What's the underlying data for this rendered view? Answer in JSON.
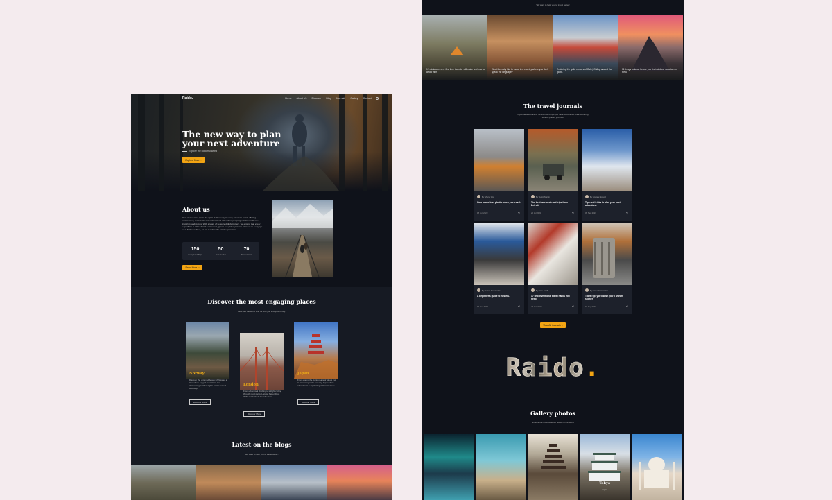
{
  "left": {
    "nav": {
      "logo": "Raido.",
      "links": [
        "Home",
        "About Us",
        "Discover",
        "Blog",
        "Journals",
        "Gallery",
        "Contact"
      ]
    },
    "hero": {
      "title": "The new way to plan your next adventure",
      "subtitle": "Explore the colourful world",
      "cta": "Explore More"
    },
    "about": {
      "title": "About us",
      "body": "Our mission is to ignite the spirit of discovery in every traveler's heart, offering meticulously crafted itineraries that blend adrenaline-pumping activities with awe-inspiring landscapes. With a team of seasoned globetrotters, we ensure that every expedition is infused with excitement, grows our global passion. Join us on a voyage of a lifetime with us, as we redefine the art of exploration.",
      "stats": [
        {
          "value": "150",
          "label": "Completed Trips"
        },
        {
          "value": "50",
          "label": "Tour Guides"
        },
        {
          "value": "70",
          "label": "Destinations"
        }
      ],
      "cta": "Read More"
    },
    "discover": {
      "title": "Discover the most engaging places",
      "subtitle": "Let's see the world with us with you and your family.",
      "cards": [
        {
          "name": "Norway",
          "desc": "Discover the untamed beauty of Norway, a land where rugged mountains, and shimmering northern lights paint a surreal backdrop.",
          "cta": "Discover More"
        },
        {
          "name": "London",
          "desc": "From urban rock climbing to twilight cycling through royal parks, London has endless thrills and hotbeds for adventure.",
          "cta": "Discover More"
        },
        {
          "name": "Japan",
          "desc": "From scaling the iconic peaks of Mount Fuji to immersing in the serenity, Japan offers adventurers a captivating cultural treasure.",
          "cta": "Discover More"
        }
      ]
    },
    "blogs": {
      "title": "Latest on the blogs",
      "subtitle": "We want to help you to travel better!"
    }
  },
  "right": {
    "blogs_subtitle": "We want to help you to travel better!",
    "blog_posts": [
      {
        "caption": "12 mistakes every first time traveller will make and how to avoid them"
      },
      {
        "caption": "What it's really like to move to a country where you don't speak the language?"
      },
      {
        "caption": "Exploring the quite corners of Oslo | Gallop around the globe."
      },
      {
        "caption": "11 things to know before you visit rainbow mountain in Peru."
      }
    ],
    "journals": {
      "title": "The travel journals",
      "subtitle": "A journal is a place to record new things you have discovered while exploring various places you visit.",
      "cards": [
        {
          "author": "By Sherry Ann",
          "title": "How to use less plastic when you travel.",
          "date": "18 Jun 2023"
        },
        {
          "author": "By Justin Martin",
          "title": "The best weekend road trips from Detroit.",
          "date": "20 Jul 2023"
        },
        {
          "author": "By Andrew Joseph",
          "title": "Tips and tricks to plan your next adventure.",
          "date": "09 Sep 2023"
        },
        {
          "author": "By Jennie Fernandez",
          "title": "A beginner's guide to hostels.",
          "date": "14 Dec 2023"
        },
        {
          "author": "By Jane Smith",
          "title": "17 unconventional travel hacks you need.",
          "date": "23 Jan 2023"
        },
        {
          "author": "By Karen Fernandez",
          "title": "Travel tip: you'll wish you'd known sooner.",
          "date": "15 Aug 2023"
        }
      ],
      "cta": "View All Journals"
    },
    "brand": {
      "word": "Raido",
      "dot": "."
    },
    "gallery": {
      "title": "Gallery photos",
      "subtitle": "Explore the most beautiful places in the world",
      "highlight": {
        "name": "Tokyo",
        "sub": "Japan"
      }
    }
  },
  "colors": {
    "accent": "#f2a413",
    "page_bg": "#0f121a",
    "card_bg": "#1d212b",
    "canvas": "#f4ebee"
  }
}
